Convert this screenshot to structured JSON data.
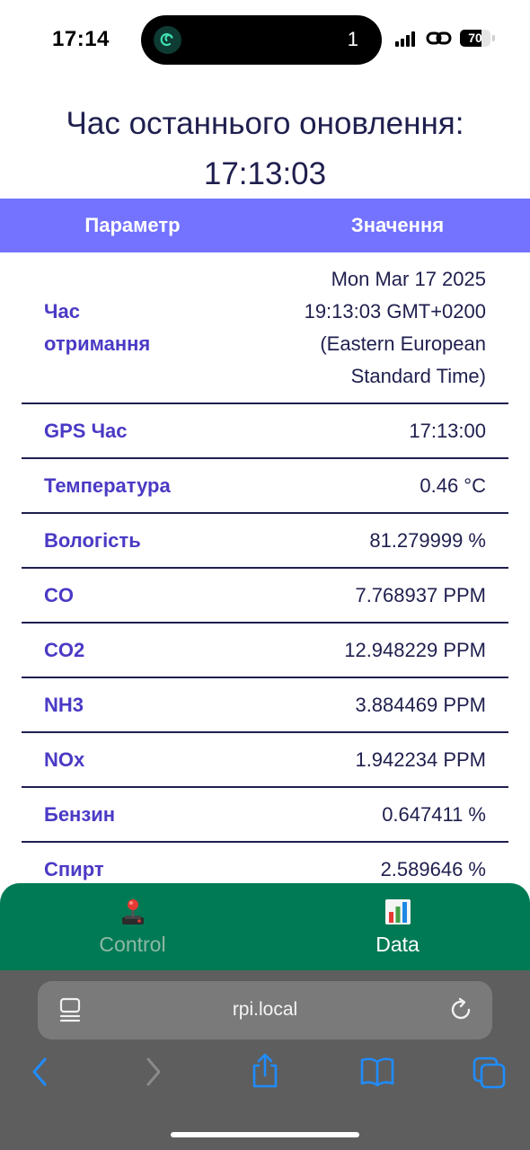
{
  "status_bar": {
    "time": "17:14",
    "island_count": "1",
    "battery": "70",
    "battery_level": 0.7
  },
  "title": {
    "line1": "Час останнього оновлення:",
    "line2": "17:13:03"
  },
  "table": {
    "headers": {
      "param": "Параметр",
      "value": "Значення"
    },
    "rows": [
      {
        "label": "Час отримання",
        "value": "Mon Mar 17 2025 19:13:03 GMT+0200 (Eastern European Standard Time)"
      },
      {
        "label": "GPS Час",
        "value": "17:13:00"
      },
      {
        "label": "Температура",
        "value": "0.46 °C"
      },
      {
        "label": "Вологість",
        "value": "81.279999 %"
      },
      {
        "label": "CO",
        "value": "7.768937 PPM"
      },
      {
        "label": "CO2",
        "value": "12.948229 PPM"
      },
      {
        "label": "NH3",
        "value": "3.884469 PPM"
      },
      {
        "label": "NOx",
        "value": "1.942234 PPM"
      },
      {
        "label": "Бензин",
        "value": "0.647411 %"
      },
      {
        "label": "Спирт",
        "value": "2.589646 %"
      }
    ]
  },
  "tabs": [
    {
      "label": "Control",
      "icon": "joystick-icon",
      "active": false
    },
    {
      "label": "Data",
      "icon": "bar-chart-icon",
      "active": true
    }
  ],
  "browser": {
    "url": "rpi.local"
  },
  "colors": {
    "header_bg": "#7373ff",
    "tab_bar_bg": "#007a55",
    "label_color": "#4a3ac5",
    "text_color": "#1f1f4f"
  }
}
